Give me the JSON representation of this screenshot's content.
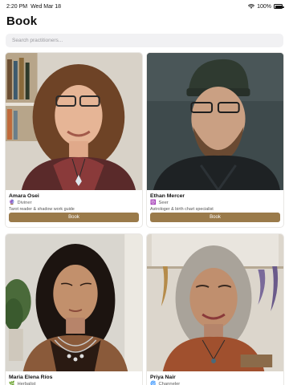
{
  "status_bar": {
    "time": "2:20 PM",
    "date": "Wed Mar 18",
    "battery": "100%",
    "battery_level": 1.0
  },
  "page": {
    "title": "Book"
  },
  "search": {
    "placeholder": "Search practitioners..."
  },
  "practitioners": [
    {
      "name": "Amara Osei",
      "role": "Diviner",
      "role_icon": "diviner-icon",
      "description": "Tarot reader & shadow work guide",
      "button_label": "Book"
    },
    {
      "name": "Ethan Mercer",
      "role": "Seer",
      "role_icon": "seer-icon",
      "description": "Astrologer & birth chart specialist",
      "button_label": "Book"
    },
    {
      "name": "Maria Elena Ríos",
      "role": "Herbalist",
      "role_icon": "herbalist-icon",
      "description": "",
      "button_label": ""
    },
    {
      "name": "Priya Nair",
      "role": "Channeler",
      "role_icon": "channeler-icon",
      "description": "",
      "button_label": ""
    }
  ],
  "colors": {
    "accent": "#9a7a4a",
    "search_bg": "#f1f1f3",
    "card_border": "#e9e7e4"
  }
}
